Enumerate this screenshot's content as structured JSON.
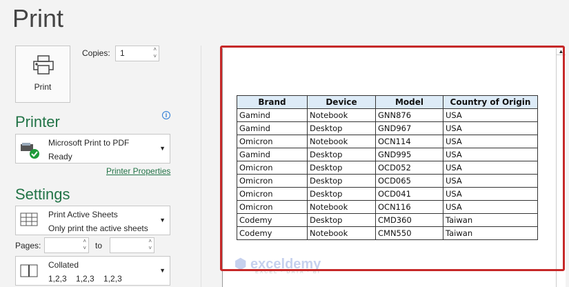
{
  "title": "Print",
  "print_button": "Print",
  "copies": {
    "label": "Copies:",
    "value": "1"
  },
  "printer": {
    "heading": "Printer",
    "name": "Microsoft Print to PDF",
    "status": "Ready",
    "properties_link": "Printer Properties"
  },
  "settings": {
    "heading": "Settings",
    "sheets": {
      "title": "Print Active Sheets",
      "subtitle": "Only print the active sheets"
    },
    "pages_label": "Pages:",
    "to_label": "to",
    "pages_from": "",
    "pages_to": "",
    "collation": {
      "title": "Collated",
      "subtitle": "1,2,3    1,2,3    1,2,3"
    }
  },
  "preview": {
    "headers": [
      "Brand",
      "Device",
      "Model",
      "Country of Origin"
    ],
    "rows": [
      [
        "Gamind",
        "Notebook",
        "GNN876",
        "USA"
      ],
      [
        "Gamind",
        "Desktop",
        "GND967",
        "USA"
      ],
      [
        "Omicron",
        "Notebook",
        "OCN114",
        "USA"
      ],
      [
        "Gamind",
        "Desktop",
        "GND995",
        "USA"
      ],
      [
        "Omicron",
        "Desktop",
        "OCD052",
        "USA"
      ],
      [
        "Omicron",
        "Desktop",
        "OCD065",
        "USA"
      ],
      [
        "Omicron",
        "Desktop",
        "OCD041",
        "USA"
      ],
      [
        "Omicron",
        "Notebook",
        "OCN116",
        "USA"
      ],
      [
        "Codemy",
        "Desktop",
        "CMD360",
        "Taiwan"
      ],
      [
        "Codemy",
        "Notebook",
        "CMN550",
        "Taiwan"
      ]
    ],
    "header_color": "#ddebf7",
    "highlight_color": "#c62828"
  },
  "watermark": {
    "brand": "exceldemy",
    "tagline": "EXCEL · DATA · BI"
  }
}
